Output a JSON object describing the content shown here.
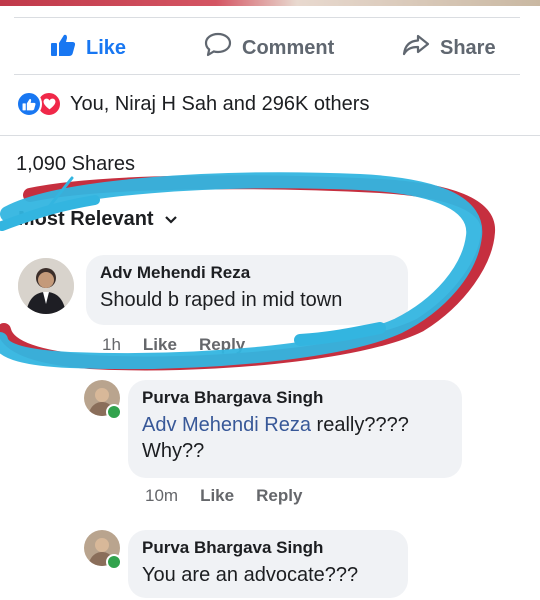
{
  "actions": {
    "like_label": "Like",
    "comment_label": "Comment",
    "share_label": "Share"
  },
  "reactions": {
    "text": "You, Niraj H Sah and 296K others"
  },
  "shares": {
    "text": "1,090 Shares"
  },
  "sort": {
    "label": "Most Relevant"
  },
  "comments": [
    {
      "author": "Adv Mehendi Reza",
      "text": "Should b raped in mid town",
      "time": "1h",
      "like": "Like",
      "reply": "Reply"
    },
    {
      "author": "Purva Bhargava Singh",
      "mention": "Adv Mehendi Reza",
      "text": " really????",
      "text2": "Why??",
      "time": "10m",
      "like": "Like",
      "reply": "Reply"
    },
    {
      "author": "Purva Bhargava Singh",
      "text": "You are an advocate???"
    }
  ],
  "colors": {
    "brand_blue": "#1877f2",
    "love_red": "#f02849",
    "scribble_cyan": "#33b5e0",
    "scribble_red": "#c0182a",
    "online_green": "#31a24c"
  }
}
